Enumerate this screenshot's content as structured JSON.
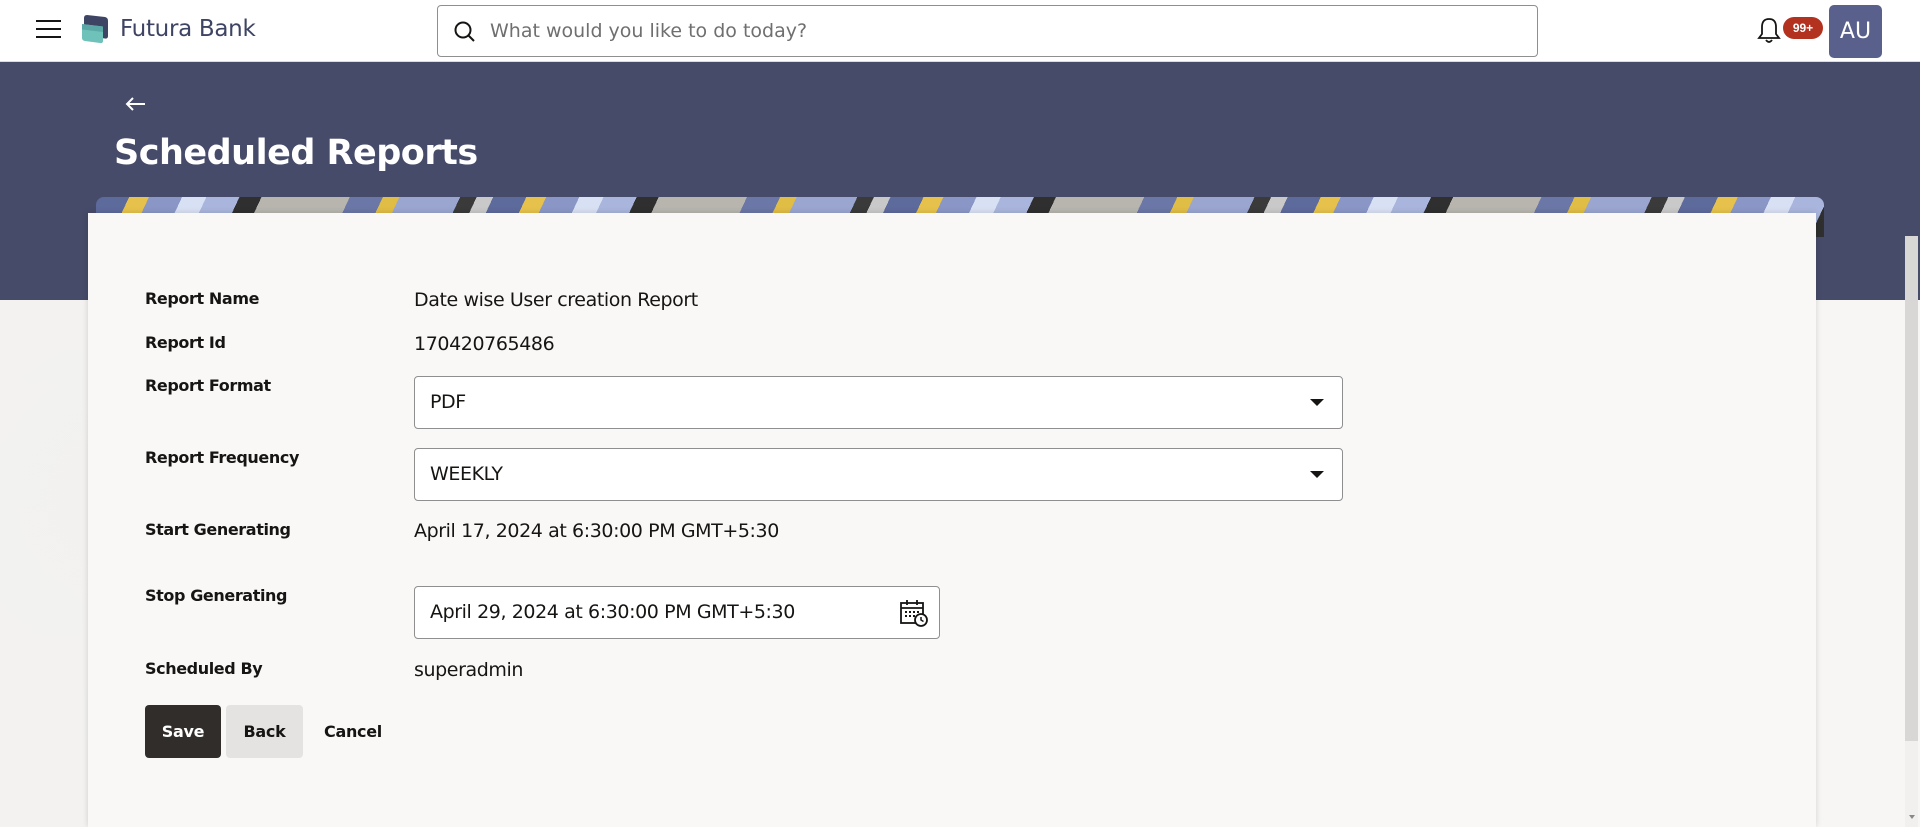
{
  "app": {
    "brand": "Futura Bank",
    "brand_colors": {
      "primary": "#464b69",
      "logo_dark": "#3e4463",
      "logo_teal": "#6fc2b9"
    }
  },
  "header": {
    "search_placeholder": "What would you like to do today?",
    "search_value": "",
    "notifications_badge": "99+",
    "avatar_initials": "AU"
  },
  "page": {
    "title": "Scheduled Reports"
  },
  "form": {
    "report_name": {
      "label": "Report Name",
      "value": "Date wise User creation Report"
    },
    "report_id": {
      "label": "Report Id",
      "value": "170420765486"
    },
    "report_format": {
      "label": "Report Format",
      "value": "PDF"
    },
    "report_frequency": {
      "label": "Report Frequency",
      "value": "WEEKLY"
    },
    "start_generating": {
      "label": "Start Generating",
      "value": "April 17, 2024 at 6:30:00 PM GMT+5:30"
    },
    "stop_generating": {
      "label": "Stop Generating",
      "value": "April 29, 2024 at 6:30:00 PM GMT+5:30"
    },
    "scheduled_by": {
      "label": "Scheduled By",
      "value": "superadmin"
    }
  },
  "actions": {
    "save": "Save",
    "back": "Back",
    "cancel": "Cancel"
  },
  "icons": {
    "menu": "hamburger-icon",
    "logo": "futura-bank-logo-icon",
    "search": "search-icon",
    "notifications": "bell-icon",
    "back": "arrow-left-icon",
    "dropdown": "caret-down-icon",
    "date_picker": "calendar-clock-icon"
  }
}
